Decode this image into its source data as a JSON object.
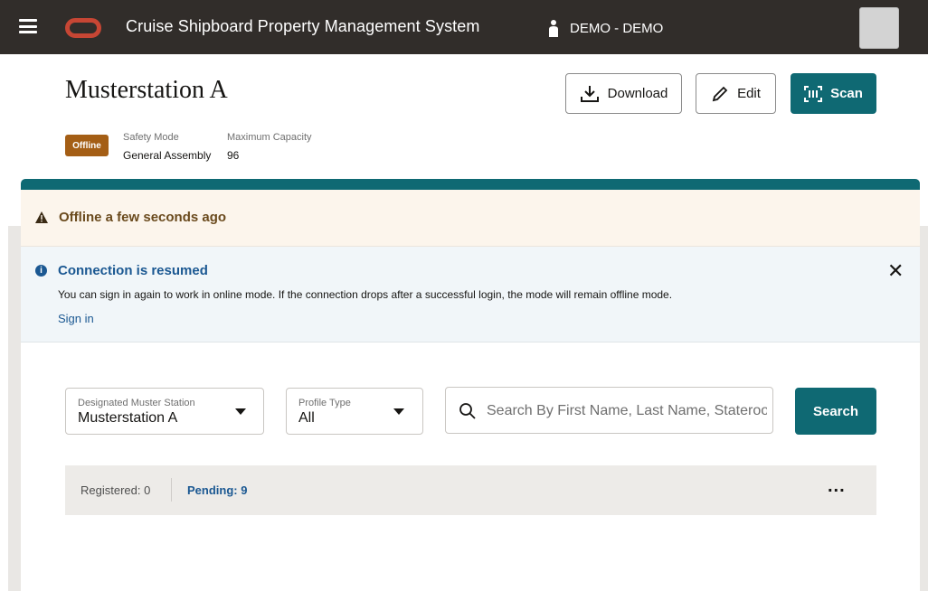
{
  "header": {
    "app_title": "Cruise Shipboard Property Management System",
    "user": "DEMO - DEMO"
  },
  "page": {
    "title": "Musterstation A",
    "download_label": "Download",
    "edit_label": "Edit",
    "scan_label": "Scan",
    "status_badge": "Offline",
    "safety_mode_label": "Safety Mode",
    "safety_mode_value": "General Assembly",
    "capacity_label": "Maximum Capacity",
    "capacity_value": "96"
  },
  "warning_banner": {
    "text": "Offline a few seconds ago"
  },
  "info_banner": {
    "title": "Connection is resumed",
    "body": "You can sign in again to work in online mode. If the connection drops after a successful login, the mode will remain offline mode.",
    "link": "Sign in"
  },
  "filters": {
    "muster_station_label": "Designated Muster Station",
    "muster_station_value": "Musterstation A",
    "profile_type_label": "Profile Type",
    "profile_type_value": "All",
    "search_placeholder": "Search By First Name, Last Name, Stateroom",
    "search_button": "Search"
  },
  "status": {
    "registered": "Registered: 0",
    "pending": "Pending: 9",
    "more": "..."
  },
  "colors": {
    "topbar": "#312d2a",
    "accent": "#0f6973",
    "oracle_red": "#c74634",
    "badge_offline": "#a45e15",
    "link_blue": "#1b5892",
    "warning_bg": "#fcf5ec",
    "info_bg": "#f1f6f9"
  }
}
